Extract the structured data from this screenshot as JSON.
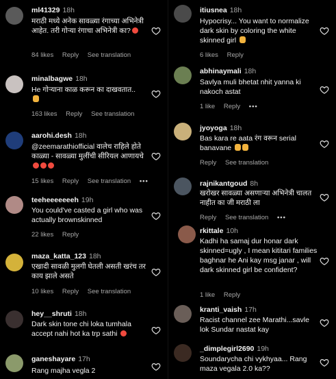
{
  "left": {
    "comments": [
      {
        "username": "ml41329",
        "time": "18h",
        "text": "मराठी मध्ये अनेक सावळ्या रंगाच्या अभिनेत्री आहेत. तरी गोऱ्या रंगाचा अभिनेत्री का?",
        "likes": "84 likes",
        "reply": "Reply",
        "translate": "See translation",
        "avatar": "#5a5a5a"
      },
      {
        "username": "minalbagwe",
        "time": "18h",
        "text": "He गोऱ्याना काळ करून का दाखवतात..",
        "likes": "163 likes",
        "reply": "Reply",
        "translate": "See translation",
        "avatar": "#c9c2c0"
      },
      {
        "username": "aarohi.desh",
        "time": "18h",
        "text": "@zeemarathiofficial वालेच राहिले होते काळ्या - सावळ्या मुलींची सीरियल आणायचे",
        "likes": "15 likes",
        "reply": "Reply",
        "translate": "See translation",
        "avatar": "#1f3d7a"
      },
      {
        "username": "teeheeeeeeeh",
        "time": "19h",
        "text": "You could've casted a girl who was actually brownskinned",
        "likes": "22 likes",
        "reply": "Reply",
        "translate": "",
        "avatar": "#b08a86"
      },
      {
        "username": "maza_katta_123",
        "time": "18h",
        "text": "एखादी सावळी मुलगी घेतली असती खरंच तर काय झाले असते",
        "likes": "10 likes",
        "reply": "Reply",
        "translate": "See translation",
        "avatar": "#d4b23a"
      },
      {
        "username": "hey__shruti",
        "time": "18h",
        "text": "Dark skin tone chi loka tumhala accept nahi hot ka trp sathi",
        "likes": "",
        "reply": "",
        "translate": "",
        "avatar": "#3a3030"
      },
      {
        "username": "ganeshayare",
        "time": "17h",
        "text": "Rang majha vegla 2",
        "likes": "",
        "reply": "",
        "translate": "",
        "avatar": "#8b9a6b"
      }
    ]
  },
  "right": {
    "comments": [
      {
        "username": "itiusnea",
        "time": "18h",
        "text": "Hypocrisy... You want to normalize dark skin by coloring the white skinned girl",
        "likes": "6 likes",
        "reply": "Reply",
        "translate": "",
        "avatar": "#4a4a4a"
      },
      {
        "username": "abhinaymali",
        "time": "18h",
        "text": "Savlya muli bhetat nhit yanna ki nakoch astat",
        "likes": "1 like",
        "reply": "Reply",
        "translate": "",
        "avatar": "#6b7f52"
      },
      {
        "username": "jyoyoga",
        "time": "18h",
        "text": "Bas kara re aata रंग वरून serial banavane",
        "likes": "",
        "reply": "Reply",
        "translate": "See translation",
        "avatar": "#c9b07a"
      },
      {
        "username": "rajnikantgoud",
        "time": "8h",
        "text": "खरोखर सावळ्या असणाऱ्या अभिनेत्री चालत नाहीत का जी मराठी ला",
        "likes": "",
        "reply": "Reply",
        "translate": "See translation",
        "avatar": "#4b5560"
      },
      {
        "username": "rkittale",
        "time": "10h",
        "text": "Kadhi ha samaj dur honar dark skinned=ugly , I mean kititari families baghnar he Ani kay msg janar , will dark skinned girl be confident?",
        "likes": "1 like",
        "reply": "Reply",
        "translate": "",
        "avatar": "#8a5a4a"
      },
      {
        "username": "kranti_vaish",
        "time": "17h",
        "text": "Racist channel zee Marathi...savle lok Sundar nastat kay",
        "likes": "",
        "reply": "",
        "translate": "",
        "avatar": "#6a5e58"
      },
      {
        "username": "_dimplegirl2690",
        "time": "19h",
        "text": "Soundarycha chi vykhyaa... Rang maza vegala 2.0 ka??",
        "likes": "",
        "reply": "",
        "translate": "",
        "avatar": "#3b2a22"
      }
    ]
  },
  "dots": "•••"
}
